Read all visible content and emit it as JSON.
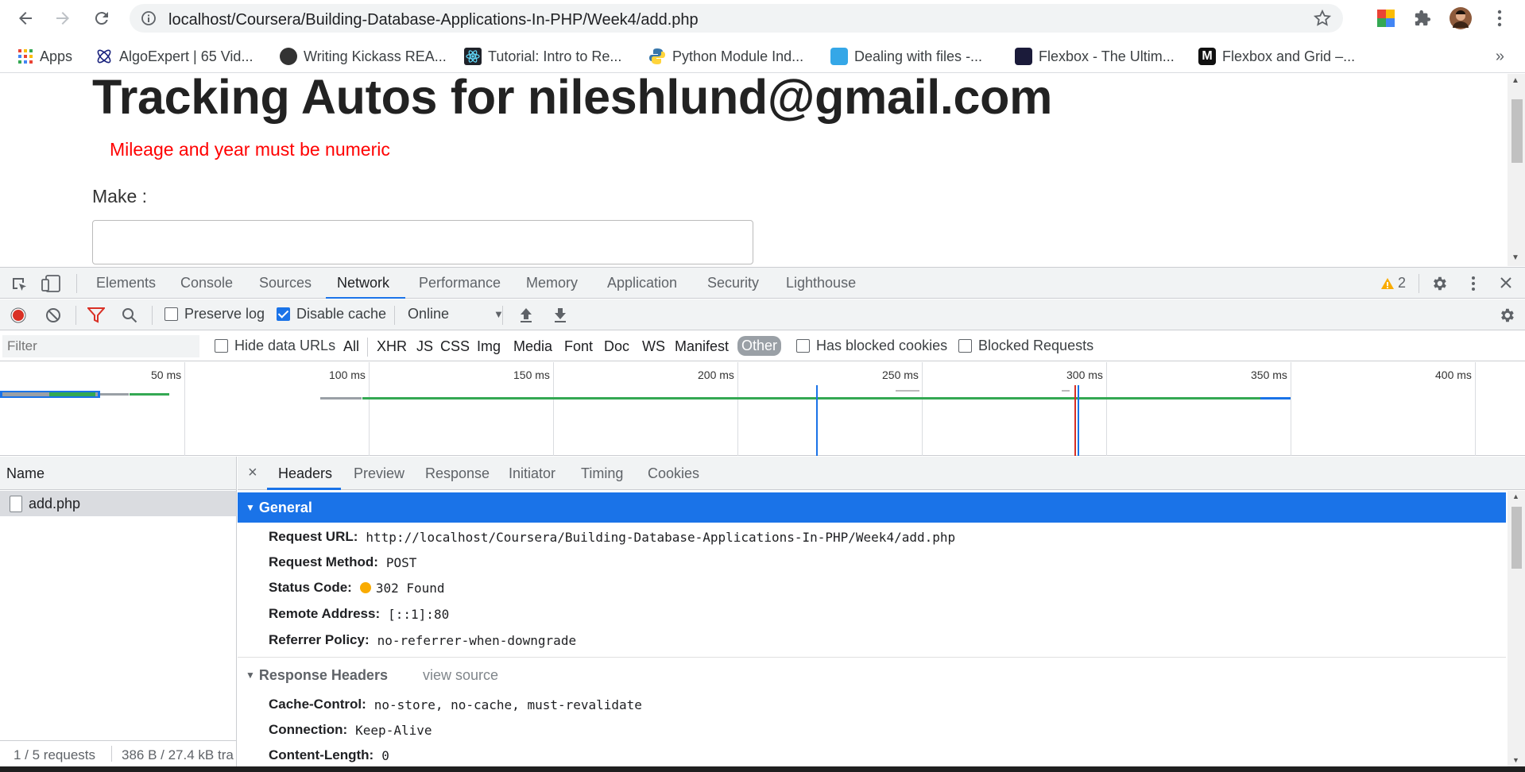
{
  "browser": {
    "url": "localhost/Coursera/Building-Database-Applications-In-PHP/Week4/add.php",
    "bookmarks": [
      {
        "label": "Apps",
        "color": "#4285f4"
      },
      {
        "label": "AlgoExpert | 65 Vid...",
        "color": "#1a237e"
      },
      {
        "label": "Writing Kickass REA...",
        "color": "#222222"
      },
      {
        "label": "Tutorial: Intro to Re...",
        "color": "#61dafb"
      },
      {
        "label": "Python Module Ind...",
        "color": "#3776ab"
      },
      {
        "label": "Dealing with files -...",
        "color": "#35a7e7"
      },
      {
        "label": "Flexbox - The Ultim...",
        "color": "#1b1b3a"
      },
      {
        "label": "Flexbox and Grid –...",
        "color": "#111111"
      }
    ],
    "more": "»"
  },
  "page": {
    "title": "Tracking Autos for nileshlund@gmail.com",
    "error": "Mileage and year must be numeric",
    "make_label": "Make :",
    "make_value": ""
  },
  "devtools": {
    "tabs": [
      "Elements",
      "Console",
      "Sources",
      "Network",
      "Performance",
      "Memory",
      "Application",
      "Security",
      "Lighthouse"
    ],
    "active_tab": "Network",
    "warning_count": "2",
    "toolbar": {
      "preserve_log": "Preserve log",
      "disable_cache": "Disable cache",
      "throttle": "Online"
    },
    "filter": {
      "placeholder": "Filter",
      "hide_data_urls": "Hide data URLs",
      "types": [
        "All",
        "XHR",
        "JS",
        "CSS",
        "Img",
        "Media",
        "Font",
        "Doc",
        "WS",
        "Manifest",
        "Other"
      ],
      "active_type": "Other",
      "has_blocked_cookies": "Has blocked cookies",
      "blocked_requests": "Blocked Requests"
    },
    "overview_ticks": [
      "50 ms",
      "100 ms",
      "150 ms",
      "200 ms",
      "250 ms",
      "300 ms",
      "350 ms",
      "400 ms"
    ],
    "requests": {
      "header": "Name",
      "rows": [
        "add.php"
      ],
      "footer_count": "1 / 5 requests",
      "footer_size": "386 B / 27.4 kB tra"
    },
    "details": {
      "close": "×",
      "tabs": [
        "Headers",
        "Preview",
        "Response",
        "Initiator",
        "Timing",
        "Cookies"
      ],
      "active_tab": "Headers",
      "general": {
        "title": "General",
        "request_url_k": "Request URL:",
        "request_url_v": "http://localhost/Coursera/Building-Database-Applications-In-PHP/Week4/add.php",
        "request_method_k": "Request Method:",
        "request_method_v": "POST",
        "status_code_k": "Status Code:",
        "status_code_v": "302 Found",
        "remote_address_k": "Remote Address:",
        "remote_address_v": "[::1]:80",
        "referrer_policy_k": "Referrer Policy:",
        "referrer_policy_v": "no-referrer-when-downgrade"
      },
      "response_headers": {
        "title": "Response Headers",
        "view_source": "view source",
        "cache_control_k": "Cache-Control:",
        "cache_control_v": "no-store, no-cache, must-revalidate",
        "connection_k": "Connection:",
        "connection_v": "Keep-Alive",
        "content_length_k": "Content-Length:",
        "content_length_v": "0"
      }
    }
  },
  "colors": {
    "accent": "#1a73e8",
    "error": "#ff0000",
    "record": "#d93025",
    "status_dot": "#f9ab00"
  }
}
